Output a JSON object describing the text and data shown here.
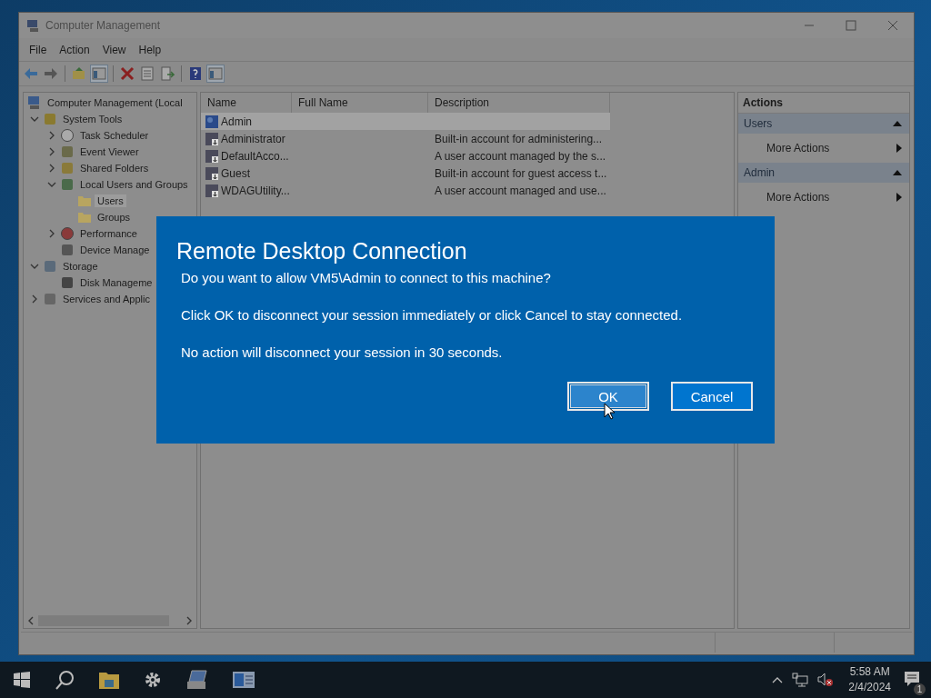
{
  "window": {
    "title": "Computer Management"
  },
  "menu": [
    "File",
    "Action",
    "View",
    "Help"
  ],
  "toolbar": [
    {
      "kind": "back",
      "pressed": false
    },
    {
      "kind": "forward",
      "pressed": false
    },
    {
      "kind": "sep"
    },
    {
      "kind": "up",
      "pressed": false
    },
    {
      "kind": "tree",
      "pressed": true
    },
    {
      "kind": "sep"
    },
    {
      "kind": "delete",
      "pressed": false
    },
    {
      "kind": "properties",
      "pressed": false
    },
    {
      "kind": "export",
      "pressed": false
    },
    {
      "kind": "sep"
    },
    {
      "kind": "help",
      "pressed": false
    },
    {
      "kind": "pane",
      "pressed": true
    }
  ],
  "tree": [
    {
      "label": "Computer Management (Local",
      "kind": "computer",
      "selected": false,
      "children": [
        {
          "label": "System Tools",
          "kind": "tools",
          "expanded": true,
          "selected": false,
          "children": [
            {
              "label": "Task Scheduler",
              "kind": "clock",
              "expanded": false,
              "selected": false
            },
            {
              "label": "Event Viewer",
              "kind": "viewer",
              "expanded": false,
              "selected": false
            },
            {
              "label": "Shared Folders",
              "kind": "share",
              "expanded": false,
              "selected": false
            },
            {
              "label": "Local Users and Groups",
              "kind": "users",
              "expanded": true,
              "selected": false,
              "children": [
                {
                  "label": "Users",
                  "kind": "folder",
                  "selected": true
                },
                {
                  "label": "Groups",
                  "kind": "folder",
                  "selected": false
                }
              ]
            },
            {
              "label": "Performance",
              "kind": "performance",
              "expanded": false,
              "selected": false
            },
            {
              "label": "Device Manage",
              "kind": "device",
              "selected": false
            }
          ]
        },
        {
          "label": "Storage",
          "kind": "storage",
          "expanded": true,
          "selected": false,
          "children": [
            {
              "label": "Disk Manageme",
              "kind": "disk",
              "selected": false
            }
          ]
        },
        {
          "label": "Services and Applic",
          "kind": "services",
          "expanded": false,
          "selected": false
        }
      ]
    }
  ],
  "table": {
    "columns": [
      "Name",
      "Full Name",
      "Description"
    ],
    "rows": [
      {
        "cells": [
          "Admin",
          "",
          ""
        ],
        "kind": "admin",
        "selected": true
      },
      {
        "cells": [
          "Administrator",
          "",
          "Built-in account for administering..."
        ],
        "kind": "user",
        "selected": false
      },
      {
        "cells": [
          "DefaultAcco...",
          "",
          "A user account managed by the s..."
        ],
        "kind": "user",
        "selected": false
      },
      {
        "cells": [
          "Guest",
          "",
          "Built-in account for guest access t..."
        ],
        "kind": "user",
        "selected": false
      },
      {
        "cells": [
          "WDAGUtility...",
          "",
          "A user account managed and use..."
        ],
        "kind": "user",
        "selected": false
      }
    ]
  },
  "actions": {
    "title": "Actions",
    "sections": [
      {
        "title": "Users",
        "expanded": true,
        "items": [
          "More Actions"
        ]
      },
      {
        "title": "Admin",
        "expanded": true,
        "items": [
          "More Actions"
        ]
      }
    ]
  },
  "dialog": {
    "title": "Remote Desktop Connection",
    "paragraphs": [
      "Do you want to allow VM5\\Admin to connect to this machine?",
      "Click OK to disconnect your session immediately or click Cancel to stay connected.",
      "No action will disconnect your session in 30 seconds."
    ],
    "buttons": [
      {
        "label": "OK",
        "focused": true
      },
      {
        "label": "Cancel",
        "focused": false
      }
    ]
  },
  "taskbar": {
    "apps": [
      {
        "kind": "explorer"
      },
      {
        "kind": "settings"
      },
      {
        "kind": "rdp"
      },
      {
        "kind": "management"
      }
    ],
    "time": "5:58 AM",
    "date": "2/4/2024",
    "notifications": "1"
  }
}
